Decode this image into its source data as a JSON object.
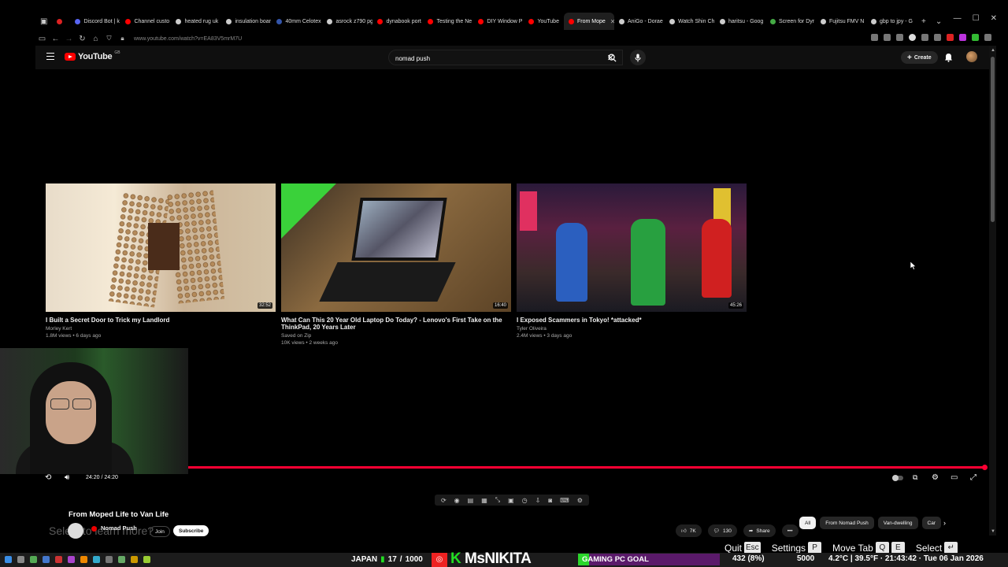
{
  "browser": {
    "tabs": [
      {
        "label": "",
        "color": "#dd2222"
      },
      {
        "label": "Discord Bot | k",
        "color": "#5865f2"
      },
      {
        "label": "Channel custo",
        "color": "#ff0000"
      },
      {
        "label": "heated rug uk",
        "color": "#cccccc"
      },
      {
        "label": "insulation boar",
        "color": "#cccccc"
      },
      {
        "label": "40mm Celotex",
        "color": "#3355aa"
      },
      {
        "label": "asrock z790 pg",
        "color": "#cccccc"
      },
      {
        "label": "dynabook port",
        "color": "#ff0000"
      },
      {
        "label": "Testing the Ne",
        "color": "#ff0000"
      },
      {
        "label": "DIY Window P",
        "color": "#ff0000"
      },
      {
        "label": "YouTube",
        "color": "#ff0000"
      },
      {
        "label": "From Mope",
        "color": "#ff0000",
        "active": true
      },
      {
        "label": "AniGo - Doraе",
        "color": "#cccccc"
      },
      {
        "label": "Watch Shin Ch",
        "color": "#cccccc"
      },
      {
        "label": "haritsu - Goog",
        "color": "#cccccc"
      },
      {
        "label": "Screen for Dyr",
        "color": "#44aa44"
      },
      {
        "label": "Fujitsu FMV N",
        "color": "#cccccc"
      },
      {
        "label": "gbp to jpy - G",
        "color": "#cccccc"
      }
    ],
    "new_tab": "+",
    "tab_list": "⌄",
    "url": "www.youtube.com/watch?v=EA83V5mrM7U",
    "window_controls": [
      "—",
      "☐",
      "✕"
    ]
  },
  "header": {
    "logo_text": "YouTube",
    "logo_suffix": "GB",
    "search_value": "nomad push",
    "create_label": "Create"
  },
  "endscreen": {
    "videos": [
      {
        "title": "I Built a Secret Door to Trick my Landlord",
        "channel": "Morley Kert",
        "meta": "1.8M views • 6 days ago",
        "duration": "32:52"
      },
      {
        "title": "What Can This 20 Year Old Laptop Do Today? - Lenovo's First Take on the ThinkPad, 20 Years Later",
        "channel": "Saved on Zip",
        "meta": "10K views • 2 weeks ago",
        "duration": "16:40"
      },
      {
        "title": "I Exposed Scammers in Tokyo! *attacked*",
        "channel": "Tyler Oliveira",
        "meta": "2.4M views • 3 days ago",
        "duration": "45:26"
      }
    ]
  },
  "player": {
    "time": "24:20 / 24:20",
    "progress": 1.0
  },
  "video": {
    "title": "From Moped Life to Van Life",
    "channel": "Nomad Push",
    "join_label": "Join",
    "subscribe_label": "Subscribe",
    "likes": "7K",
    "comments": "130",
    "share_label": "Share",
    "more": "•••",
    "ghost_caption": "Select to learn more?"
  },
  "chips": [
    "All",
    "From Nomad Push",
    "Van-dwelling",
    "Car"
  ],
  "overlay": {
    "hotkeys": [
      {
        "label": "Quit",
        "key": "Esc"
      },
      {
        "label": "Settings",
        "key": "P"
      },
      {
        "label": "Move Tab",
        "key": "Q",
        "key2": "E"
      },
      {
        "label": "Select",
        "key": "↵"
      }
    ]
  },
  "taskbar": {
    "region": "JAPAN",
    "region_level": "17",
    "region_sep": "/",
    "region_max": "1000",
    "streamer": "MsNIKITA",
    "goal_label": "GAMING PC GOAL",
    "goal_fraction": 0.08,
    "goal_count": "432 (8%)",
    "goal_target": "5000",
    "weather": "4.2°C | 39.5°F · 21:43:42 · Tue 06 Jan 2026"
  }
}
